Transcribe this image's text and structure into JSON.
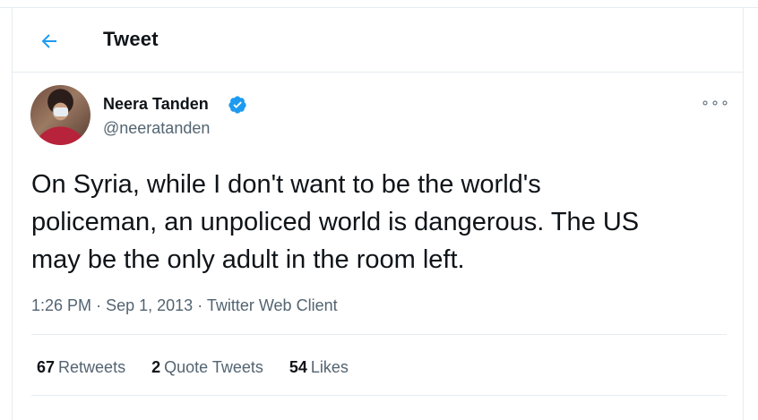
{
  "header": {
    "title": "Tweet",
    "back_icon": "arrow-left-icon"
  },
  "author": {
    "display_name": "Neera Tanden",
    "handle": "@neeratanden",
    "verified_icon": "verified-badge-icon",
    "more_icon": "more-options-icon",
    "more_glyph": "∘∘∘"
  },
  "tweet": {
    "text": "On Syria, while I don't want to be the world's\npoliceman, an unpoliced world is dangerous. The US\nmay be the only adult in the room left.",
    "time": "1:26 PM",
    "separator": "·",
    "date": "Sep 1, 2013",
    "client": "Twitter Web Client"
  },
  "stats": {
    "retweets_count": "67",
    "retweets_label": "Retweets",
    "quotes_count": "2",
    "quotes_label": "Quote Tweets",
    "likes_count": "54",
    "likes_label": "Likes"
  },
  "colors": {
    "accent": "#1d9bf0",
    "border": "#e6ecf0",
    "secondary_text": "#536471"
  }
}
